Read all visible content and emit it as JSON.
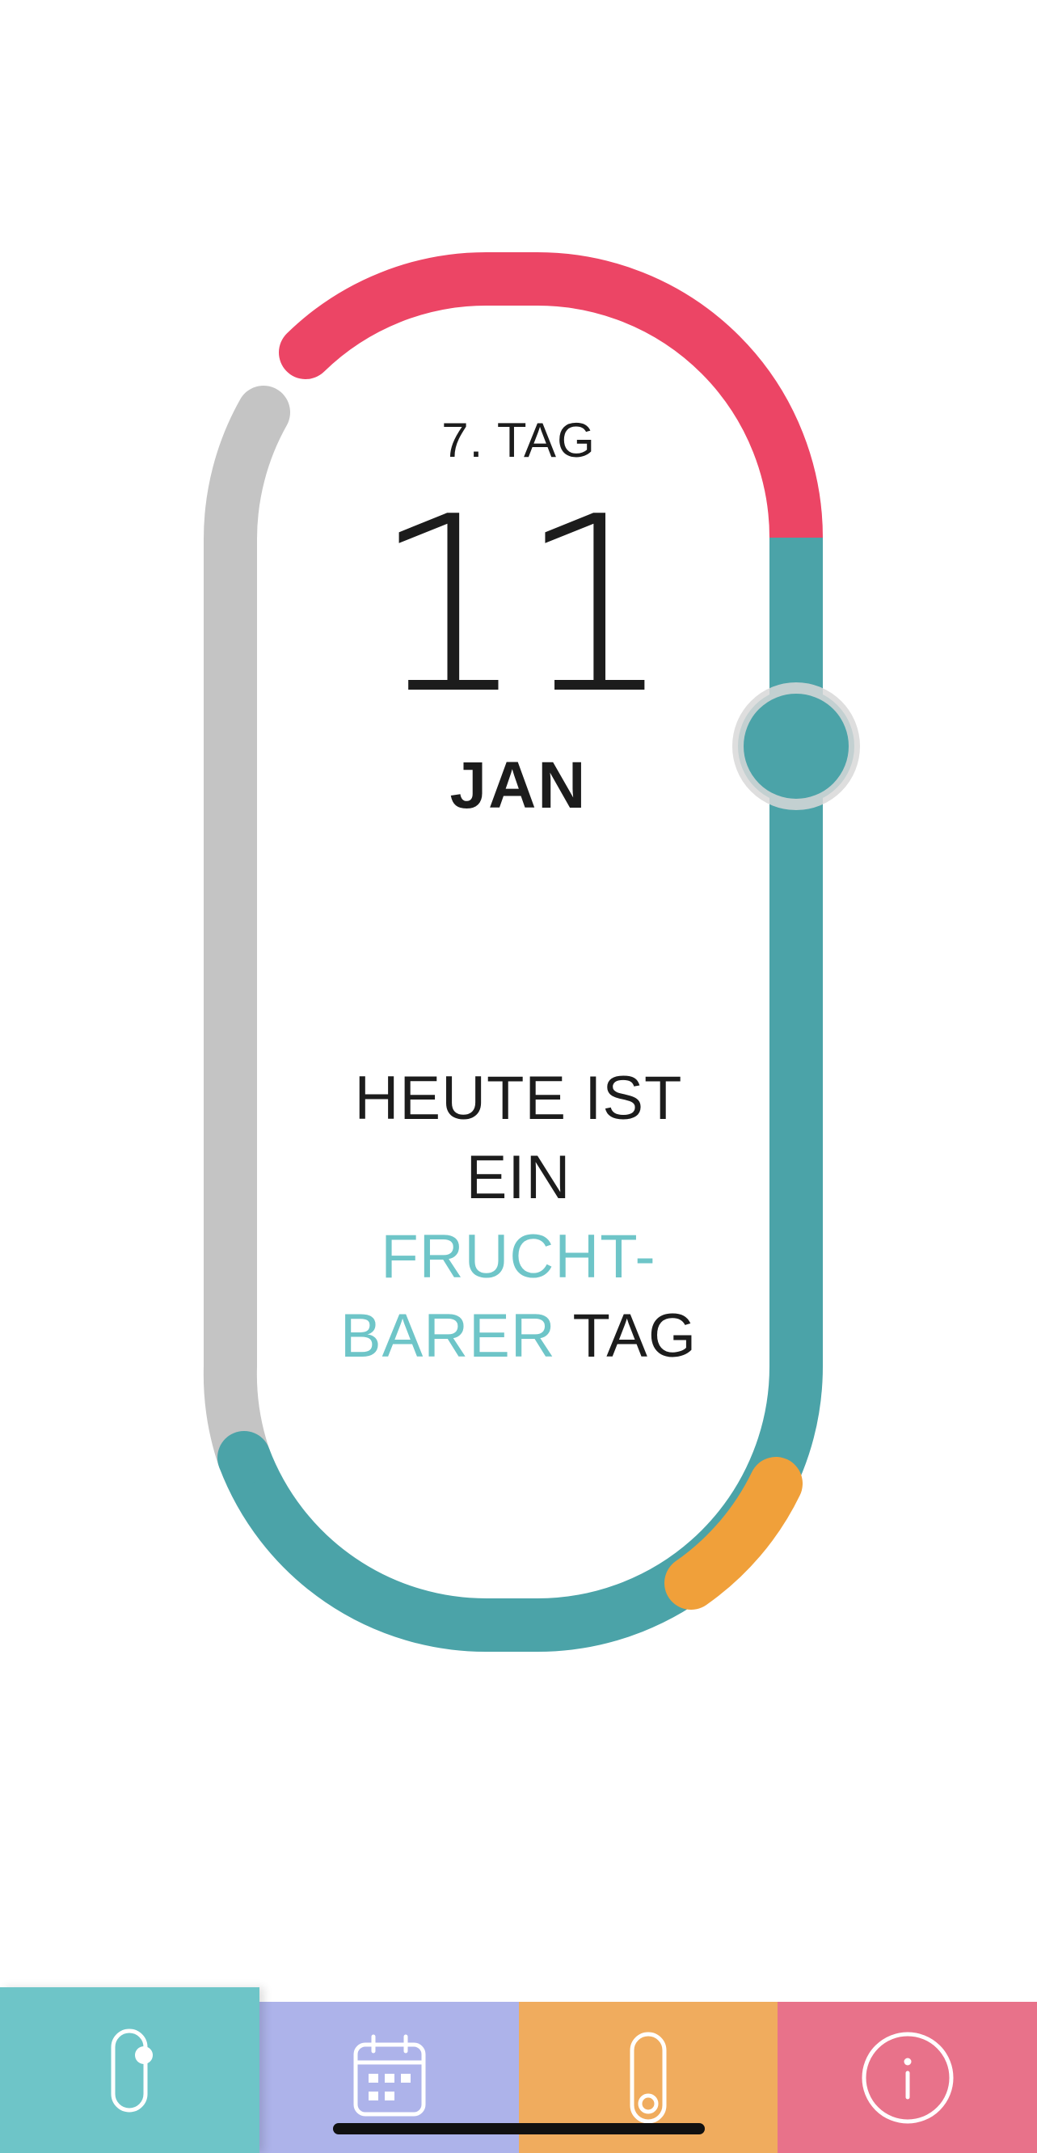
{
  "cycle": {
    "day_label": "7. TAG",
    "day_number": "11",
    "month": "JAN",
    "status_line1": "HEUTE IST",
    "status_line2": "EIN",
    "status_accent1": "FRUCHT-",
    "status_accent2": "BARER",
    "status_suffix": "TAG"
  },
  "colors": {
    "period": "#ec4565",
    "fertile": "#4ba3a8",
    "ovulation": "#f0a03a",
    "past": "#c4c4c4",
    "accent_text": "#6ec5c8"
  },
  "tabs": [
    {
      "name": "cycle",
      "icon": "cycle-pill-icon",
      "color": "#6ec5c8",
      "active": true
    },
    {
      "name": "calendar",
      "icon": "calendar-icon",
      "color": "#adb3ea",
      "active": false
    },
    {
      "name": "pill",
      "icon": "pill-icon",
      "color": "#f0ac5e",
      "active": false
    },
    {
      "name": "info",
      "icon": "info-icon",
      "color": "#e8728a",
      "active": false
    }
  ]
}
